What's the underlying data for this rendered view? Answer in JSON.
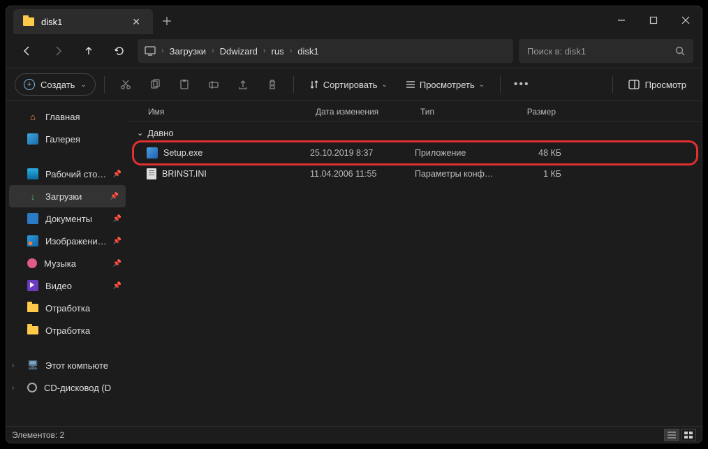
{
  "window": {
    "tab_title": "disk1"
  },
  "breadcrumbs": [
    "Загрузки",
    "Ddwizard",
    "rus",
    "disk1"
  ],
  "search": {
    "placeholder": "Поиск в: disk1"
  },
  "toolbar": {
    "create": "Создать",
    "sort": "Сортировать",
    "view": "Просмотреть",
    "details": "Просмотр"
  },
  "columns": {
    "name": "Имя",
    "date": "Дата изменения",
    "type": "Тип",
    "size": "Размер"
  },
  "sidebar": {
    "home": "Главная",
    "gallery": "Галерея",
    "desktop": "Рабочий сто…",
    "downloads": "Загрузки",
    "documents": "Документы",
    "pictures": "Изображени…",
    "music": "Музыка",
    "videos": "Видео",
    "folder1": "Отработка",
    "folder2": "Отработка",
    "thispc": "Этот компьюте",
    "cd": "CD-дисковод (D"
  },
  "group": "Давно",
  "files": [
    {
      "name": "Setup.exe",
      "date": "25.10.2019 8:37",
      "type": "Приложение",
      "size": "48 КБ",
      "icon": "exe",
      "highlighted": true
    },
    {
      "name": "BRINST.INI",
      "date": "11.04.2006 11:55",
      "type": "Параметры конф…",
      "size": "1 КБ",
      "icon": "ini",
      "highlighted": false
    }
  ],
  "status": {
    "count_label": "Элементов: 2"
  }
}
